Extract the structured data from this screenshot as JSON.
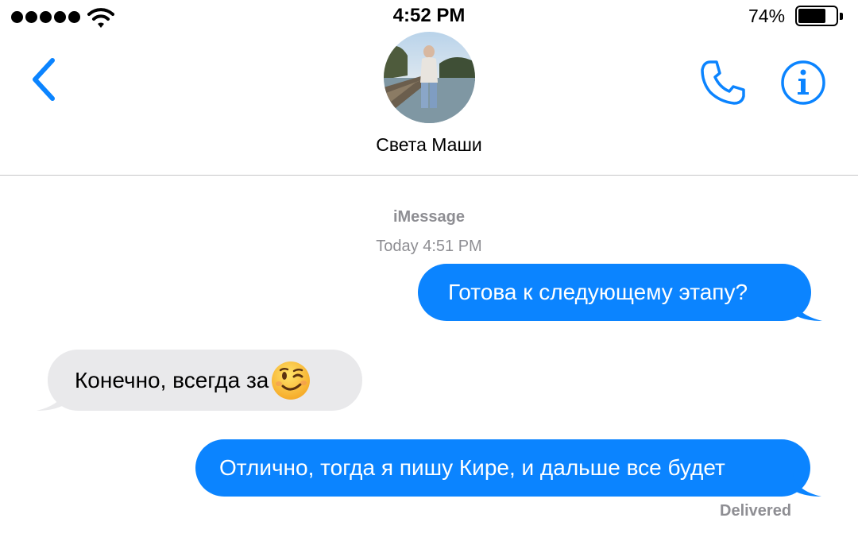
{
  "status_bar": {
    "time": "4:52 PM",
    "battery_percent": "74%",
    "battery_level": 0.74,
    "signal_icon": "signal-dots-icon",
    "wifi_icon": "wifi-icon"
  },
  "header": {
    "contact_name": "Света Маши",
    "back_icon": "chevron-left-icon",
    "call_icon": "phone-icon",
    "info_icon": "info-icon"
  },
  "conversation": {
    "service": "iMessage",
    "timestamp": "Today 4:51 PM",
    "messages": [
      {
        "direction": "outgoing",
        "text": "Готова к следующему этапу?"
      },
      {
        "direction": "incoming",
        "text": "Конечно, всегда за",
        "emoji": "winking-face"
      },
      {
        "direction": "outgoing",
        "text": "Отлично, тогда я пишу Кире, и дальше все будет"
      }
    ],
    "delivery_status": "Delivered"
  },
  "colors": {
    "accent": "#0b84ff",
    "incoming_bubble": "#e9e9eb",
    "secondary_text": "#8e8e93"
  }
}
